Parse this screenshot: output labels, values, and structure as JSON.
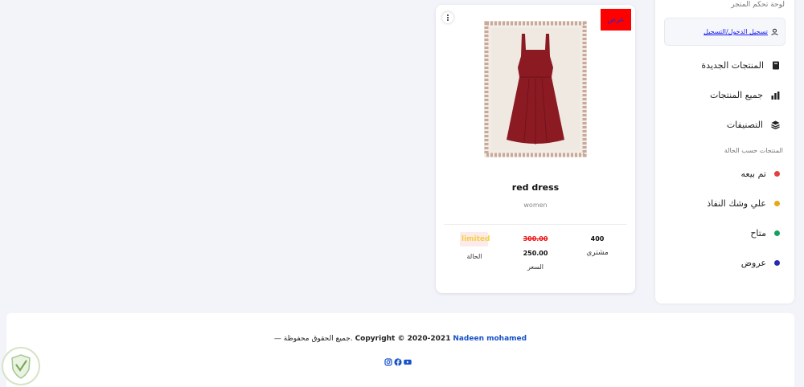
{
  "sidebar": {
    "title": "لوحة تحكم المتجر",
    "login_link": "تسجيل الدخول/التسجيل",
    "nav": [
      {
        "label": "المنتجات الجديدة",
        "icon": "book-icon"
      },
      {
        "label": "جميع المنتجات",
        "icon": "bar-chart-icon"
      },
      {
        "label": "التصنيفات",
        "icon": "layers-icon"
      }
    ],
    "status_heading": "المنتجات حسب الحالة",
    "status_items": [
      {
        "label": "تم بيعه",
        "color": "#e53e3e"
      },
      {
        "label": "علي وشك النفاذ",
        "color": "#e6a817"
      },
      {
        "label": "متاح",
        "color": "#16a05d"
      },
      {
        "label": "عروض",
        "color": "#2a2ab0"
      }
    ]
  },
  "product": {
    "badge": "عرض",
    "name": "red dress",
    "category": "women",
    "buyers_count": "400",
    "buyers_label": "مشتري",
    "old_price": "300.00",
    "new_price": "250.00",
    "price_label": "السعر",
    "status_value": "limited",
    "status_label": "الحالة"
  },
  "footer": {
    "author": "Nadeen mohamed",
    "copyright": "Copyright © 2020-2021",
    "rights": "— جميع الحقوق محفوظة."
  },
  "colors": {
    "accent": "#1650c8",
    "badge_bg": "#ff0000",
    "dress": "#8b1a22"
  }
}
